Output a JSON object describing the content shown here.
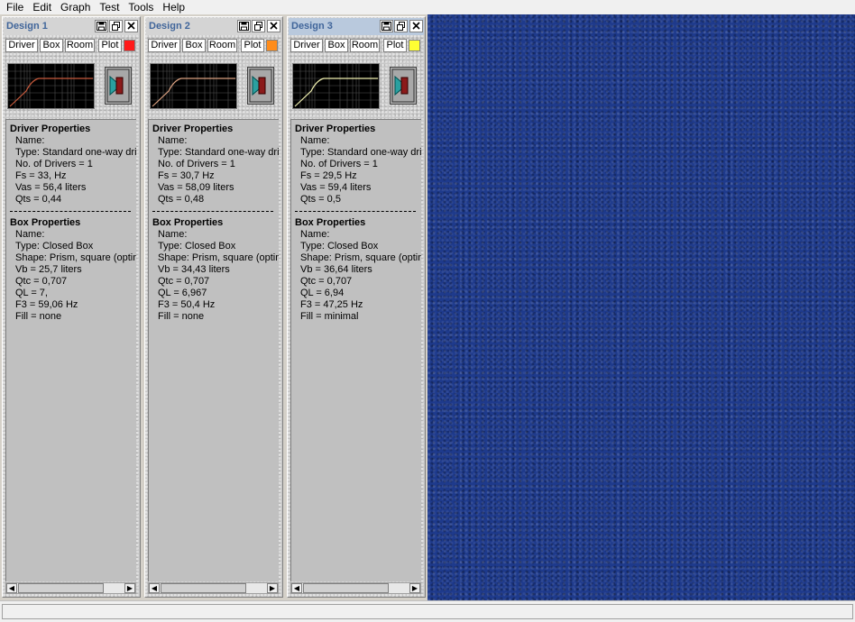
{
  "menu": [
    "File",
    "Edit",
    "Graph",
    "Test",
    "Tools",
    "Help"
  ],
  "panel_buttons": {
    "driver": "Driver",
    "box": "Box",
    "room": "Room",
    "plot": "Plot"
  },
  "icons": {
    "save": "save-icon",
    "restore": "restore-icon",
    "close": "close-icon",
    "speaker": "speaker-icon",
    "scroll_left": "scroll-left-icon",
    "scroll_right": "scroll-right-icon"
  },
  "colors": {
    "desktop": "#1e3a8c",
    "active_title": "#b9c9dd",
    "title_text": "#40659a"
  },
  "designs": [
    {
      "title": "Design 1",
      "color": "#ff1a1a",
      "curve_color": "#c85a3c",
      "driver_heading": "Driver Properties",
      "driver": [
        "Name:",
        "Type: Standard one-way driver",
        "No. of Drivers = 1",
        "Fs =  33, Hz",
        "Vas =  56,4 liters",
        "Qts =  0,44"
      ],
      "box_heading": "Box Properties",
      "box": [
        "Name:",
        "Type: Closed Box",
        "Shape: Prism, square (optimum)",
        "Vb =  25,7 liters",
        "Qtc =  0,707",
        "QL =  7,",
        "F3 =  59,06 Hz",
        "Fill = none"
      ]
    },
    {
      "title": "Design 2",
      "color": "#ff8c1a",
      "curve_color": "#d9a080",
      "driver_heading": "Driver Properties",
      "driver": [
        "Name:",
        "Type: Standard one-way driver",
        "No. of Drivers = 1",
        "Fs =  30,7 Hz",
        "Vas =  58,09 liters",
        "Qts =  0,48"
      ],
      "box_heading": "Box Properties",
      "box": [
        "Name:",
        "Type: Closed Box",
        "Shape: Prism, square (optimum)",
        "Vb =  34,43 liters",
        "Qtc =  0,707",
        "QL =  6,967",
        "F3 =  50,4 Hz",
        "Fill = none"
      ]
    },
    {
      "title": "Design 3",
      "color": "#ffff33",
      "curve_color": "#f0f0b0",
      "driver_heading": "Driver Properties",
      "driver": [
        "Name:",
        "Type: Standard one-way driver",
        "No. of Drivers = 1",
        "Fs =  29,5 Hz",
        "Vas =  59,4 liters",
        "Qts =  0,5"
      ],
      "box_heading": "Box Properties",
      "box": [
        "Name:",
        "Type: Closed Box",
        "Shape: Prism, square (optimum)",
        "Vb =  36,64 liters",
        "Qtc =  0,707",
        "QL =  6,94",
        "F3 =  47,25 Hz",
        "Fill = minimal"
      ]
    }
  ]
}
